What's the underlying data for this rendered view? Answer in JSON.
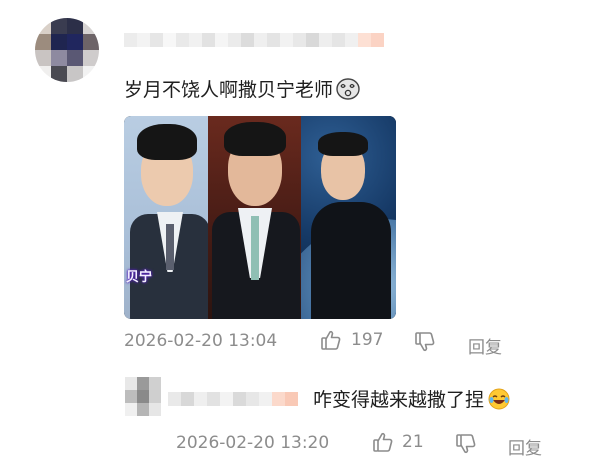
{
  "comment": {
    "text": "岁月不饶人啊撒贝宁老师",
    "image_caption": "贝宁",
    "timestamp": "2026-02-20 13:04",
    "like_count": "197",
    "reply_label": "回复"
  },
  "reply": {
    "text": "咋变得越来越撒了捏",
    "timestamp": "2026-02-20 13:20",
    "like_count": "21",
    "reply_label": "回复"
  },
  "icons": {
    "face": "dizzy-face-icon",
    "laugh": "laughing-tears-icon",
    "like": "thumbs-up-icon",
    "dislike": "thumbs-down-icon"
  },
  "colors": {
    "meta_text": "#8c8c8c",
    "body_text": "#1f1f1f"
  }
}
